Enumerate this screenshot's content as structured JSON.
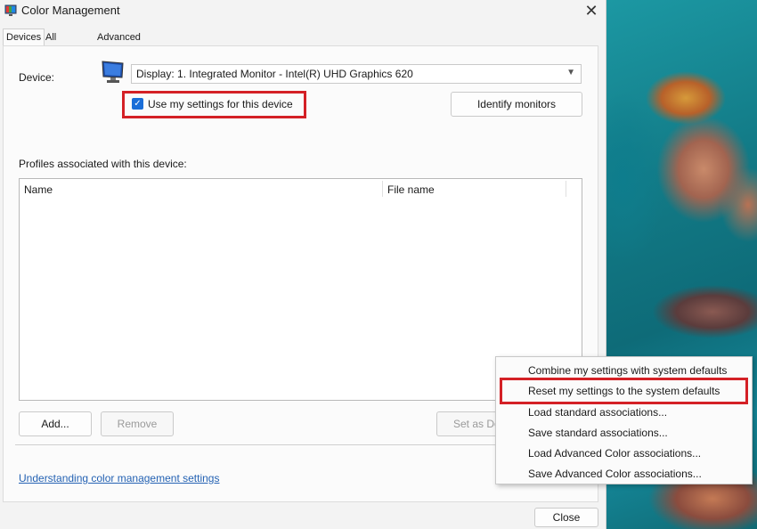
{
  "window": {
    "title": "Color Management",
    "close_glyph": "✕"
  },
  "tabs": [
    {
      "label": "Devices",
      "active": true
    },
    {
      "label": "All Profiles",
      "active": false
    },
    {
      "label": "Advanced",
      "active": false
    }
  ],
  "devices": {
    "device_label": "Device:",
    "device_value": "Display: 1. Integrated Monitor - Intel(R) UHD Graphics 620",
    "use_settings_label": "Use my settings for this device",
    "use_settings_checked": true,
    "identify_button": "Identify monitors",
    "profiles_label": "Profiles associated with this device:",
    "columns": [
      "Name",
      "File name"
    ],
    "add_button": "Add...",
    "remove_button": "Remove",
    "set_default_button_visible": "Set as De",
    "link": "Understanding color management settings",
    "close_button": "Close"
  },
  "context_menu": {
    "items": [
      "Combine my settings with system defaults",
      "Reset my settings to the system defaults",
      "Load standard associations...",
      "Save standard associations...",
      "Load Advanced Color associations...",
      "Save Advanced Color associations..."
    ]
  },
  "colors": {
    "highlight": "#d42026",
    "checkbox": "#1a6ed8",
    "link": "#2462b3"
  }
}
